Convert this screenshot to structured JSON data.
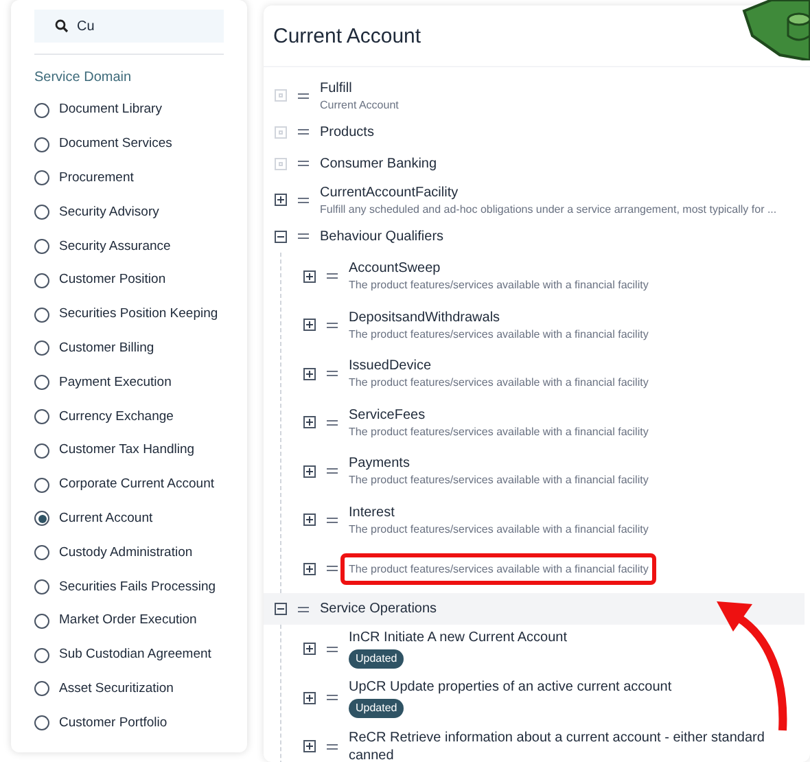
{
  "search": {
    "value": "Cu"
  },
  "sidebar": {
    "heading": "Service Domain",
    "items": [
      {
        "label": "Document Library",
        "selected": false
      },
      {
        "label": "Document Services",
        "selected": false
      },
      {
        "label": "Procurement",
        "selected": false
      },
      {
        "label": "Security Advisory",
        "selected": false
      },
      {
        "label": "Security Assurance",
        "selected": false
      },
      {
        "label": "Customer Position",
        "selected": false
      },
      {
        "label": "Securities Position Keeping",
        "selected": false
      },
      {
        "label": "Customer Billing",
        "selected": false
      },
      {
        "label": "Payment Execution",
        "selected": false
      },
      {
        "label": "Currency Exchange",
        "selected": false
      },
      {
        "label": "Customer Tax Handling",
        "selected": false
      },
      {
        "label": "Corporate Current Account",
        "selected": false
      },
      {
        "label": "Current Account",
        "selected": true
      },
      {
        "label": "Custody Administration",
        "selected": false
      },
      {
        "label": "Securities Fails Processing",
        "selected": false
      },
      {
        "label": "Market Order Execution",
        "selected": false
      },
      {
        "label": "Sub Custodian Agreement",
        "selected": false
      },
      {
        "label": "Asset Securitization",
        "selected": false
      },
      {
        "label": "Customer Portfolio",
        "selected": false
      }
    ]
  },
  "panel": {
    "title": "Current Account",
    "tree": [
      {
        "label": "Fulfill",
        "description": "Current Account",
        "disabled": true,
        "expanded": false,
        "highlighted": false
      },
      {
        "label": "Products",
        "disabled": true,
        "expanded": false,
        "highlighted": false
      },
      {
        "label": "Consumer Banking",
        "disabled": true,
        "expanded": false,
        "highlighted": false
      },
      {
        "label": "CurrentAccountFacility",
        "description": "Fulfill any scheduled and ad-hoc obligations under a service arrangement, most typically for ...",
        "disabled": false,
        "expanded": false,
        "highlighted": false
      },
      {
        "label": "Behaviour Qualifiers",
        "disabled": false,
        "expanded": true,
        "highlighted": false,
        "children": [
          {
            "label": "AccountSweep",
            "description": "The product features/services available with a financial facility",
            "marked": false
          },
          {
            "label": "DepositsandWithdrawals",
            "description": "The product features/services available with a financial facility",
            "marked": false
          },
          {
            "label": "IssuedDevice",
            "description": "The product features/services available with a financial facility",
            "marked": false
          },
          {
            "label": "ServiceFees",
            "description": "The product features/services available with a financial facility",
            "marked": false
          },
          {
            "label": "Payments",
            "description": "The product features/services available with a financial facility",
            "marked": false
          },
          {
            "label": "Interest",
            "description": "The product features/services available with a financial facility",
            "marked": false
          },
          {
            "description": "The product features/services available with a financial facility",
            "marked": true
          }
        ]
      },
      {
        "label": "Service Operations",
        "disabled": false,
        "expanded": true,
        "highlighted": true,
        "children": [
          {
            "label": "InCR Initiate A new Current Account",
            "badge": "Updated",
            "marked": false
          },
          {
            "label": "UpCR Update properties of an active current account",
            "badge": "Updated",
            "marked": false
          },
          {
            "label": "ReCR Retrieve information about a current account - either standard canned",
            "marked": false
          }
        ]
      }
    ]
  }
}
